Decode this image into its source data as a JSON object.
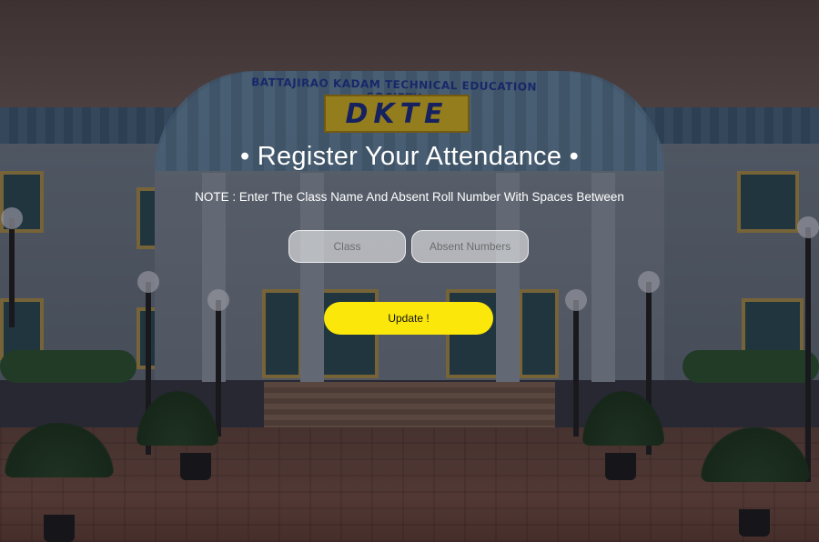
{
  "building": {
    "society_name": "BATTAJIRAO KADAM TECHNICAL EDUCATION SOCIETY",
    "logo_text": "DKTE"
  },
  "form": {
    "title": "• Register Your Attendance •",
    "note": "NOTE : Enter The Class Name And Absent Roll Number With Spaces Between",
    "class_input": {
      "value": "",
      "placeholder": "Class"
    },
    "absent_input": {
      "value": "",
      "placeholder": "Absent Numbers"
    },
    "submit_label": "Update !"
  },
  "colors": {
    "button_bg": "#fbe80a",
    "title_text": "#ffffff",
    "logo_bg": "#e9c421",
    "logo_text": "#1d2f8f"
  }
}
